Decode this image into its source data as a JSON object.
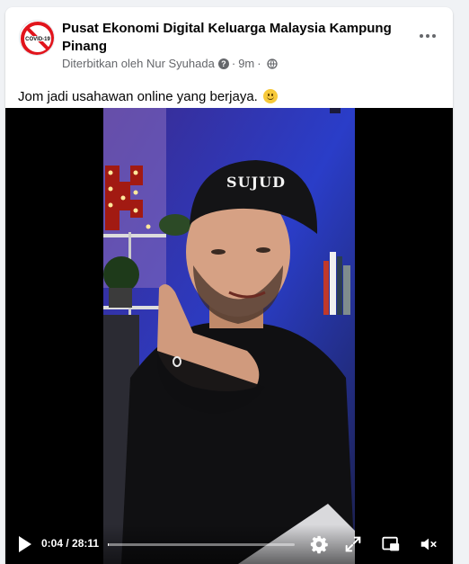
{
  "post": {
    "page_name": "Pusat Ekonomi Digital Keluarga Malaysia Kampung Pinang",
    "meta": {
      "published_by_label": "Diterbitkan oleh",
      "author": "Nur Syuhada",
      "separator": "·",
      "time": "9m",
      "help_icon": "question-icon",
      "audience_icon": "globe-icon"
    },
    "avatar": {
      "text": "COVID-19",
      "icon": "no-covid-icon"
    },
    "text": "Jom jadi usahawan online yang berjaya.",
    "emoji_icon": "smile-emoji-icon",
    "more_icon": "ellipsis-icon"
  },
  "video": {
    "overlay_text": "SUJUD",
    "current_time": "0:04",
    "time_separator": " / ",
    "duration": "28:11",
    "progress_fraction": 0.0024,
    "icons": [
      "play-icon",
      "settings-icon",
      "fullscreen-icon",
      "picture-in-picture-icon",
      "mute-icon"
    ]
  },
  "colors": {
    "page_bg": "#f0f2f5",
    "card_bg": "#ffffff",
    "primary_text": "#050505",
    "secondary_text": "#65676b",
    "video_bg": "#000000"
  }
}
